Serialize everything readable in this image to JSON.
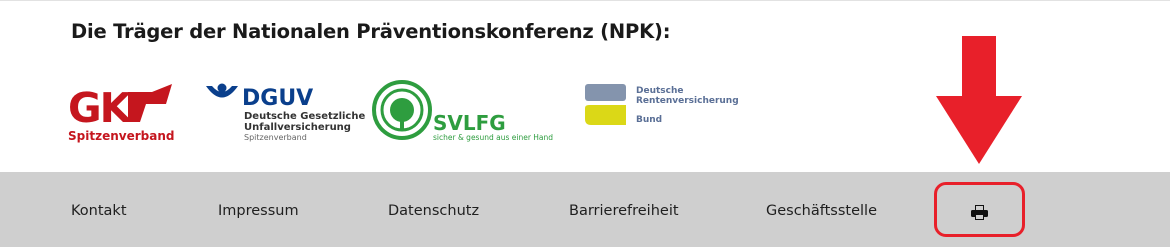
{
  "heading": "Die Träger der Nationalen Präventionskonferenz (NPK):",
  "logos": {
    "gkv": {
      "sub": "Spitzenverband"
    },
    "dguv": {
      "name": "DGUV",
      "line1": "Deutsche Gesetzliche",
      "line2": "Unfallversicherung",
      "line3": "Spitzenverband"
    },
    "svlfg": {
      "name": "SVLFG",
      "tagline": "sicher & gesund aus einer Hand"
    },
    "drv": {
      "line1": "Deutsche",
      "line2": "Rentenversicherung",
      "line3": "Bund"
    }
  },
  "footer": {
    "links": [
      "Kontakt",
      "Impressum",
      "Datenschutz",
      "Barrierefreiheit",
      "Geschäftsstelle"
    ],
    "print_icon": "printer-icon"
  },
  "colors": {
    "footer_bg": "#cfcfcf",
    "gkv_red": "#c5161e",
    "dguv_blue": "#0a3f8c",
    "svlfg_green": "#2e9d3f",
    "drv_grey": "#8494ad",
    "drv_yellow": "#dbd817",
    "annotation_red": "#e8202a"
  }
}
